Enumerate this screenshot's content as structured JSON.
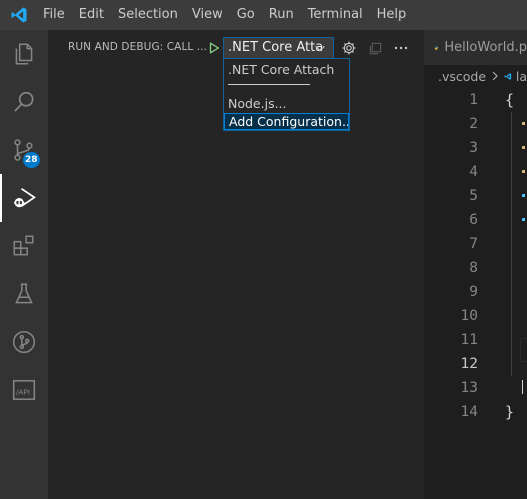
{
  "menu": [
    "File",
    "Edit",
    "Selection",
    "View",
    "Go",
    "Run",
    "Terminal",
    "Help"
  ],
  "activity": {
    "source_control_badge": "28"
  },
  "sidebar": {
    "title": "RUN AND DEBUG: CALL ...",
    "selected_config": ".NET Core Atta"
  },
  "dropdown": {
    "options": [
      ".NET Core Attach",
      "Node.js...",
      "Add Configuration..."
    ],
    "selected": "Add Configuration..."
  },
  "editor": {
    "tab_label": "HelloWorld.p",
    "breadcrumb": [
      ".vscode",
      "la"
    ],
    "line_numbers": [
      "1",
      "2",
      "3",
      "4",
      "5",
      "6",
      "7",
      "8",
      "9",
      "10",
      "11",
      "12",
      "13",
      "14"
    ],
    "current_line": "12",
    "first_line_text": "{",
    "last_line_text": "}"
  },
  "colors": {
    "accent": "#007acc",
    "selection_border": "#007fd4",
    "run_green": "#89d185"
  }
}
